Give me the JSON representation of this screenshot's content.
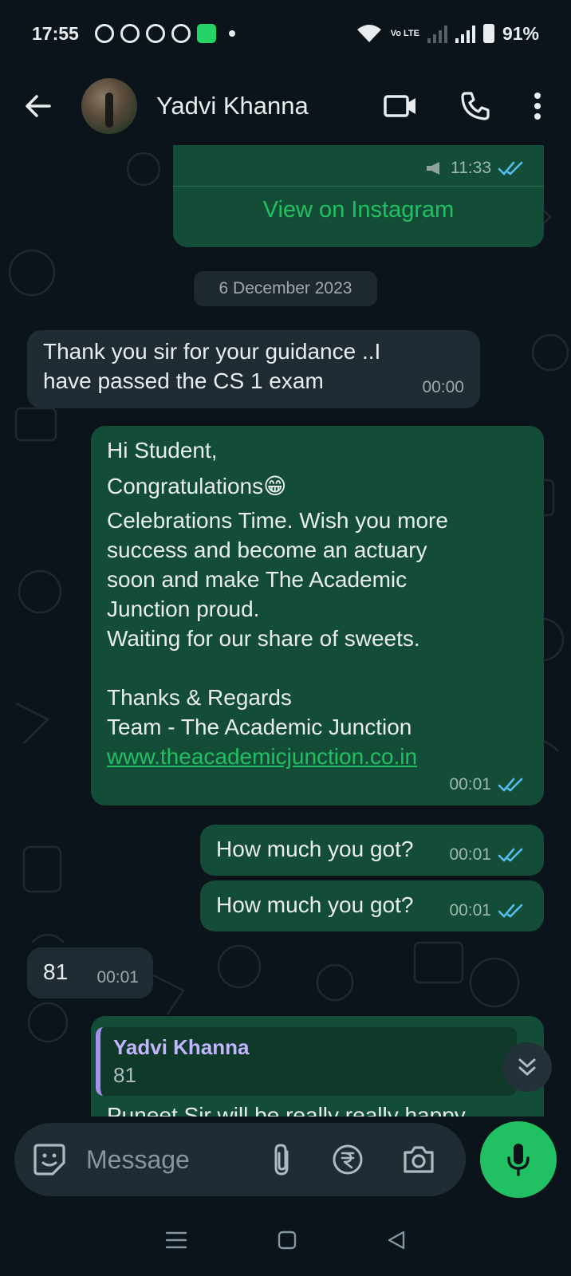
{
  "status_bar": {
    "time": "17:55",
    "network": "Vo LTE",
    "battery": "91%"
  },
  "header": {
    "contact_name": "Yadvi Khanna",
    "icons": [
      "back-arrow-icon",
      "video-call-icon",
      "voice-call-icon",
      "more-options-icon"
    ]
  },
  "messages": {
    "instagram": {
      "time": "11:33",
      "link_label": "View on Instagram"
    },
    "date_chip": "6 December 2023",
    "m1": {
      "lines": [
        "Thank you sir for your guidance ..I",
        "have passed the CS 1 exam"
      ],
      "time": "00:00"
    },
    "m2": {
      "lines": [
        "Hi Student,",
        "Congratulations",
        "Celebrations Time. Wish you more",
        "success and become an actuary",
        "soon and make The Academic",
        "Junction proud.",
        "Waiting for our share of sweets.",
        "",
        "Thanks & Regards",
        "Team - The Academic Junction"
      ],
      "emoji": "😁",
      "link": "www.theacademicjunction.co.in",
      "time": "00:01"
    },
    "m3": {
      "text": "How much you got?",
      "time": "00:01"
    },
    "m4": {
      "text": "How much you got?",
      "time": "00:01"
    },
    "m5": {
      "text": "81",
      "time": "00:01"
    },
    "m6": {
      "quote_name": "Yadvi Khanna",
      "quote_text": "81",
      "partial_text": "Puneet Sir will be really really happy"
    }
  },
  "input": {
    "placeholder": "Message"
  },
  "colors": {
    "background": "#0b141a",
    "outgoing_bubble": "#144d37",
    "incoming_bubble": "#202c33",
    "accent": "#21c063",
    "read_ticks": "#53bdeb"
  }
}
